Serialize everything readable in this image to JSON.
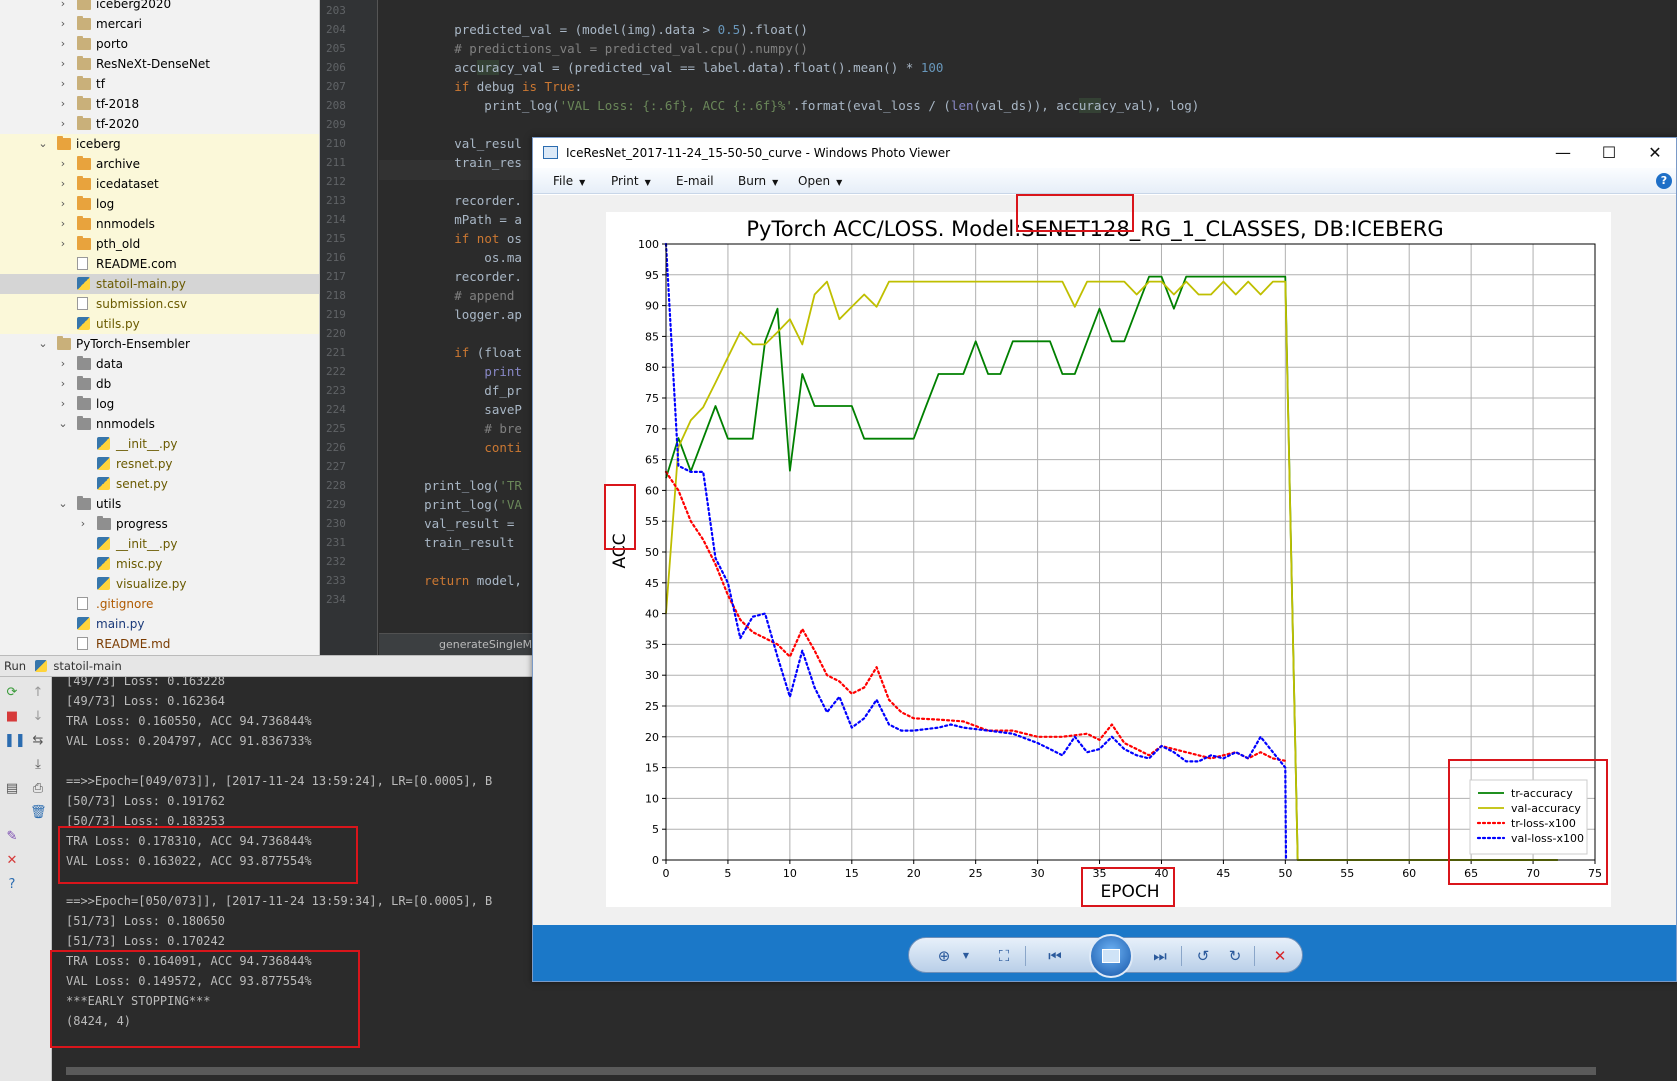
{
  "project_tree": [
    {
      "label": "iceberg2020",
      "depth": 1,
      "type": "folder",
      "collapsed": true
    },
    {
      "label": "mercari",
      "depth": 1,
      "type": "folder",
      "collapsed": true
    },
    {
      "label": "porto",
      "depth": 1,
      "type": "folder",
      "collapsed": true
    },
    {
      "label": "ResNeXt-DenseNet",
      "depth": 1,
      "type": "folder",
      "collapsed": true
    },
    {
      "label": "tf",
      "depth": 1,
      "type": "folder",
      "collapsed": true
    },
    {
      "label": "tf-2018",
      "depth": 1,
      "type": "folder",
      "collapsed": true
    },
    {
      "label": "tf-2020",
      "depth": 1,
      "type": "folder",
      "collapsed": true
    },
    {
      "label": "iceberg",
      "depth": 0,
      "type": "folder-orange",
      "collapsed": false,
      "hl": true
    },
    {
      "label": "archive",
      "depth": 1,
      "type": "folder-orange",
      "collapsed": true,
      "hl": true
    },
    {
      "label": "icedataset",
      "depth": 1,
      "type": "folder-orange",
      "collapsed": true,
      "hl": true
    },
    {
      "label": "log",
      "depth": 1,
      "type": "folder-orange",
      "collapsed": true,
      "hl": true
    },
    {
      "label": "nnmodels",
      "depth": 1,
      "type": "folder-orange",
      "collapsed": true,
      "hl": true
    },
    {
      "label": "pth_old",
      "depth": 1,
      "type": "folder-orange",
      "collapsed": true,
      "hl": true
    },
    {
      "label": "README.com",
      "depth": 1,
      "type": "file",
      "hl": true
    },
    {
      "label": "statoil-main.py",
      "depth": 1,
      "type": "py",
      "sel": true
    },
    {
      "label": "submission.csv",
      "depth": 1,
      "type": "file-py",
      "hl": true
    },
    {
      "label": "utils.py",
      "depth": 1,
      "type": "py",
      "hl": true
    },
    {
      "label": "PyTorch-Ensembler",
      "depth": 0,
      "type": "folder",
      "collapsed": false
    },
    {
      "label": "data",
      "depth": 1,
      "type": "folder-dark",
      "collapsed": true
    },
    {
      "label": "db",
      "depth": 1,
      "type": "folder-dark",
      "collapsed": true
    },
    {
      "label": "log",
      "depth": 1,
      "type": "folder-dark",
      "collapsed": true
    },
    {
      "label": "nnmodels",
      "depth": 1,
      "type": "folder-dark",
      "collapsed": false
    },
    {
      "label": "__init__.py",
      "depth": 2,
      "type": "py"
    },
    {
      "label": "resnet.py",
      "depth": 2,
      "type": "py"
    },
    {
      "label": "senet.py",
      "depth": 2,
      "type": "py"
    },
    {
      "label": "utils",
      "depth": 1,
      "type": "folder-dark",
      "collapsed": false
    },
    {
      "label": "progress",
      "depth": 2,
      "type": "folder-dark",
      "collapsed": true
    },
    {
      "label": "__init__.py",
      "depth": 2,
      "type": "py"
    },
    {
      "label": "misc.py",
      "depth": 2,
      "type": "py"
    },
    {
      "label": "visualize.py",
      "depth": 2,
      "type": "py"
    },
    {
      "label": ".gitignore",
      "depth": 1,
      "type": "git"
    },
    {
      "label": "main.py",
      "depth": 1,
      "type": "main"
    },
    {
      "label": "README.md",
      "depth": 1,
      "type": "md"
    }
  ],
  "editor": {
    "line_numbers": [
      "203",
      "204",
      "205",
      "206",
      "207",
      "208",
      "209",
      "210",
      "211",
      "212",
      "213",
      "214",
      "215",
      "216",
      "217",
      "218",
      "219",
      "220",
      "221",
      "222",
      "223",
      "224",
      "225",
      "226",
      "227",
      "228",
      "229",
      "230",
      "231",
      "232",
      "233",
      "234"
    ],
    "breadcrumb": "generateSingleM...    fo"
  },
  "run": {
    "label": "Run",
    "config": "statoil-main",
    "console_lines": [
      "[49/73] Loss: 0.163228",
      "[49/73] Loss: 0.162364",
      "TRA Loss: 0.160550, ACC 94.736844%",
      "VAL Loss: 0.204797, ACC 91.836733%",
      "",
      "==>>Epoch=[049/073]], [2017-11-24 13:59:24], LR=[0.0005], B",
      "[50/73] Loss: 0.191762",
      "[50/73] Loss: 0.183253",
      "TRA Loss: 0.178310, ACC 94.736844%",
      "VAL Loss: 0.163022, ACC 93.877554%",
      "",
      "==>>Epoch=[050/073]], [2017-11-24 13:59:34], LR=[0.0005], B",
      "[51/73] Loss: 0.180650",
      "[51/73] Loss: 0.170242",
      "TRA Loss: 0.164091, ACC 94.736844%",
      "VAL Loss: 0.149572, ACC 93.877554%",
      "***EARLY STOPPING***",
      "(8424, 4)"
    ]
  },
  "viewer": {
    "title": "IceResNet_2017-11-24_15-50-50_curve - Windows Photo Viewer",
    "menu": [
      "File",
      "Print",
      "E-mail",
      "Burn",
      "Open"
    ],
    "help": "?",
    "win_min": "—",
    "win_max": "☐",
    "win_close": "✕"
  },
  "colors": {
    "tr_accuracy": "#008000",
    "val_accuracy": "#bfbf00",
    "tr_loss": "#ff0000",
    "val_loss": "#0000ff",
    "annotation": "#d9151b"
  },
  "chart_data": {
    "type": "line",
    "title": "PyTorch ACC/LOSS. Model:SENET128_RG_1_CLASSES, DB:ICEBERG",
    "xlabel": "EPOCH",
    "ylabel": "ACC",
    "xlim": [
      0,
      75
    ],
    "ylim": [
      0,
      100
    ],
    "xticks": [
      0,
      5,
      10,
      15,
      20,
      25,
      30,
      35,
      40,
      45,
      50,
      55,
      60,
      65,
      70,
      75
    ],
    "yticks": [
      0,
      5,
      10,
      15,
      20,
      25,
      30,
      35,
      40,
      45,
      50,
      55,
      60,
      65,
      70,
      75,
      80,
      85,
      90,
      95,
      100
    ],
    "grid": true,
    "legend_position": "lower-right",
    "series": [
      {
        "name": "tr-accuracy",
        "style": "solid",
        "x": [
          0,
          1,
          2,
          4,
          5,
          7,
          8,
          9,
          10,
          11,
          12,
          14,
          15,
          16,
          17,
          18,
          20,
          21,
          22,
          24,
          25,
          26,
          27,
          28,
          29,
          30,
          31,
          32,
          33,
          34,
          35,
          36,
          37,
          38,
          39,
          40,
          41,
          42,
          43,
          44,
          45,
          46,
          47,
          48,
          49,
          50,
          51,
          72
        ],
        "y": [
          62,
          68.5,
          63.1,
          73.7,
          68.4,
          68.4,
          84.2,
          89.5,
          63.2,
          78.9,
          73.7,
          73.7,
          73.7,
          68.4,
          68.4,
          68.4,
          68.4,
          73.7,
          78.9,
          78.9,
          84.2,
          78.9,
          78.9,
          84.2,
          84.2,
          84.2,
          84.2,
          78.9,
          78.9,
          84.2,
          89.5,
          84.2,
          84.2,
          89.5,
          94.7,
          94.7,
          89.5,
          94.7,
          94.7,
          94.7,
          94.7,
          94.7,
          94.7,
          94.7,
          94.7,
          94.7,
          0,
          0
        ]
      },
      {
        "name": "val-accuracy",
        "style": "solid",
        "x": [
          0,
          1,
          2,
          3,
          4,
          5,
          6,
          7,
          8,
          9,
          10,
          11,
          12,
          13,
          14,
          15,
          16,
          17,
          18,
          20,
          25,
          30,
          32,
          33,
          34,
          35,
          36,
          37,
          38,
          39,
          40,
          41,
          42,
          43,
          44,
          45,
          46,
          47,
          48,
          49,
          50,
          51,
          72
        ],
        "y": [
          40,
          67,
          71.4,
          73.5,
          77.5,
          81.6,
          85.7,
          83.7,
          83.7,
          85.7,
          87.8,
          83.7,
          91.8,
          93.9,
          87.8,
          89.8,
          91.8,
          89.8,
          93.9,
          93.9,
          93.9,
          93.9,
          93.9,
          89.8,
          93.9,
          93.9,
          93.9,
          93.9,
          91.8,
          93.9,
          93.9,
          91.8,
          93.9,
          91.8,
          91.8,
          93.9,
          91.8,
          93.9,
          91.8,
          93.9,
          93.9,
          0,
          0
        ]
      },
      {
        "name": "tr-loss-x100",
        "style": "dotted",
        "x": [
          0,
          1,
          2,
          3,
          4,
          5,
          6,
          7,
          8,
          9,
          10,
          11,
          12,
          13,
          14,
          15,
          16,
          17,
          18,
          19,
          20,
          22,
          24,
          26,
          28,
          30,
          32,
          34,
          35,
          36,
          37,
          38,
          39,
          40,
          42,
          44,
          46,
          47,
          48,
          49,
          50
        ],
        "y": [
          63,
          60,
          55,
          52,
          48,
          43,
          39,
          37,
          36,
          35,
          33,
          37.5,
          34,
          30,
          29,
          27,
          28,
          31.3,
          26,
          24,
          23,
          22.8,
          22.5,
          21,
          21,
          20,
          20,
          20.5,
          19.5,
          22,
          19,
          18,
          17,
          18.5,
          17.5,
          16.5,
          17.5,
          16.5,
          17.5,
          16.5,
          16.1
        ]
      },
      {
        "name": "val-loss-x100",
        "style": "dotted",
        "x": [
          0,
          1,
          2,
          3,
          4,
          5,
          6,
          7,
          8,
          9,
          10,
          11,
          12,
          13,
          14,
          15,
          16,
          17,
          18,
          19,
          20,
          22,
          23,
          24,
          26,
          28,
          30,
          31,
          32,
          33,
          34,
          35,
          36,
          37,
          38,
          39,
          40,
          41,
          42,
          43,
          44,
          45,
          46,
          47,
          48,
          49,
          50,
          50.05
        ],
        "y": [
          100,
          64,
          63,
          63,
          49,
          45,
          36,
          39.5,
          40,
          33,
          26.5,
          34,
          28,
          24,
          26.5,
          21.5,
          23,
          26,
          22,
          21,
          21,
          21.5,
          22,
          21.5,
          21,
          20.5,
          19,
          18,
          17,
          20,
          17.5,
          18,
          20,
          18,
          17,
          16.5,
          18.5,
          17.5,
          16,
          16,
          17,
          16.5,
          17.5,
          16.5,
          20,
          17.5,
          15,
          0
        ]
      }
    ],
    "annotation_boxes": [
      "title-model-box",
      "ylabel-box",
      "xlabel-box",
      "legend-box"
    ]
  }
}
